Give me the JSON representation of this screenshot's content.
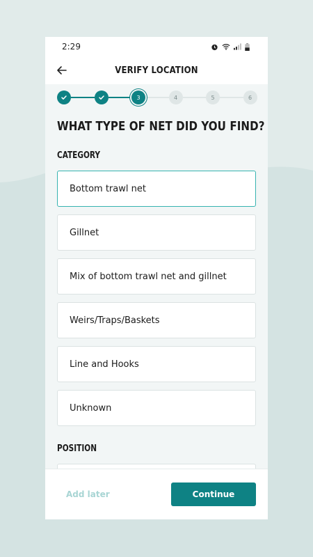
{
  "status_bar": {
    "time": "2:29",
    "icons": [
      "alarm-icon",
      "wifi-icon",
      "signal-icon",
      "battery-icon"
    ]
  },
  "header": {
    "title": "VERIFY LOCATION",
    "back_icon": "arrow-left-icon"
  },
  "stepper": {
    "steps": [
      {
        "label": "1",
        "state": "done"
      },
      {
        "label": "2",
        "state": "done"
      },
      {
        "label": "3",
        "state": "current"
      },
      {
        "label": "4",
        "state": "todo"
      },
      {
        "label": "5",
        "state": "todo"
      },
      {
        "label": "6",
        "state": "todo"
      }
    ]
  },
  "question": "WHAT TYPE OF NET DID YOU FIND?",
  "category": {
    "label": "CATEGORY",
    "options": [
      {
        "label": "Bottom trawl net",
        "selected": true
      },
      {
        "label": "Gillnet",
        "selected": false
      },
      {
        "label": "Mix of bottom trawl net and gillnet",
        "selected": false
      },
      {
        "label": "Weirs/Traps/Baskets",
        "selected": false
      },
      {
        "label": "Line and Hooks",
        "selected": false
      },
      {
        "label": "Unknown",
        "selected": false
      }
    ]
  },
  "position": {
    "label": "POSITION"
  },
  "footer": {
    "add_later": "Add later",
    "continue": "Continue"
  },
  "colors": {
    "accent": "#0e8284",
    "selected_border": "#36b3b0",
    "inactive_step": "#dfe6e6",
    "add_later": "#a8d5d4"
  }
}
